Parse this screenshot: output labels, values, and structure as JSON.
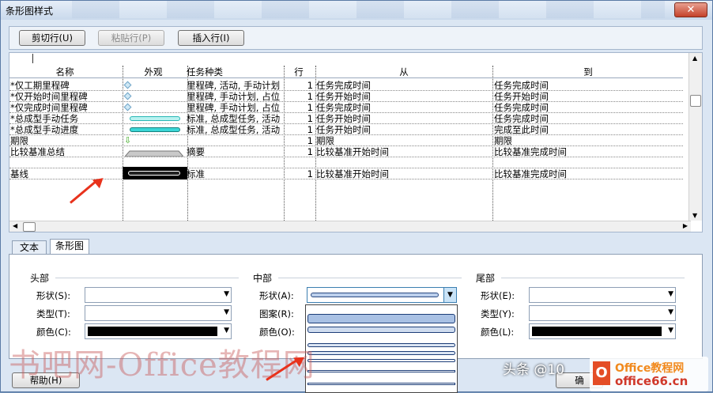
{
  "window": {
    "title": "条形图样式",
    "close_icon": "close-icon"
  },
  "toolbar": {
    "cut": "剪切行(U)",
    "paste": "粘贴行(P)",
    "insert": "插入行(I)"
  },
  "grid": {
    "headers": [
      "名称",
      "外观",
      "任务种类",
      "行",
      "从",
      "到"
    ],
    "rows": [
      {
        "name": "*仅工期里程碑",
        "appearance": "diamond",
        "kind": "里程碑, 活动, 手动计划",
        "row": "1",
        "from": "任务完成时间",
        "to": "任务完成时间"
      },
      {
        "name": "*仅开始时间里程碑",
        "appearance": "diamond",
        "kind": "里程碑, 手动计划, 占位",
        "row": "1",
        "from": "任务开始时间",
        "to": "任务开始时间"
      },
      {
        "name": "*仅完成时间里程碑",
        "appearance": "diamond",
        "kind": "里程碑, 手动计划, 占位",
        "row": "1",
        "from": "任务完成时间",
        "to": "任务完成时间"
      },
      {
        "name": "*总成型手动任务",
        "appearance": "bar-cyan",
        "kind": "标准, 总成型任务, 活动",
        "row": "1",
        "from": "任务开始时间",
        "to": "任务完成时间"
      },
      {
        "name": "*总成型手动进度",
        "appearance": "bar-teal",
        "kind": "标准, 总成型任务, 活动",
        "row": "1",
        "from": "任务开始时间",
        "to": "完成至此时间"
      },
      {
        "name": "期限",
        "appearance": "arrow-down",
        "kind": "",
        "row": "1",
        "from": "期限",
        "to": "期限"
      },
      {
        "name": "比较基准总结",
        "appearance": "summary-gray",
        "kind": "摘要",
        "row": "1",
        "from": "比较基准开始时间",
        "to": "比较基准完成时间"
      },
      {
        "name": "",
        "appearance": "",
        "kind": "",
        "row": "",
        "from": "",
        "to": ""
      },
      {
        "name": "基线",
        "appearance": "bar-black",
        "kind": "标准",
        "row": "1",
        "from": "比较基准开始时间",
        "to": "比较基准完成时间"
      }
    ]
  },
  "tabs": [
    "文本",
    "条形图"
  ],
  "panel": {
    "head": {
      "title": "头部",
      "shape": "形状(S):",
      "type": "类型(T):",
      "color": "颜色(C):"
    },
    "middle": {
      "title": "中部",
      "shape": "形状(A):",
      "pattern": "图案(R):",
      "color": "颜色(O):"
    },
    "tail": {
      "title": "尾部",
      "shape": "形状(E):",
      "type": "类型(Y):",
      "color": "颜色(L):"
    }
  },
  "help": "帮助(H)",
  "ok_partial": "确",
  "watermark": "书吧网-Office教程网",
  "credit": "头条 @10",
  "logo_top": "Office教程网",
  "logo_bottom": "office66.cn",
  "colors": {
    "title_bg": "#dbe6f3",
    "accent_red": "#e8321c",
    "cyan": "#3ad6d6",
    "black": "#000000"
  }
}
